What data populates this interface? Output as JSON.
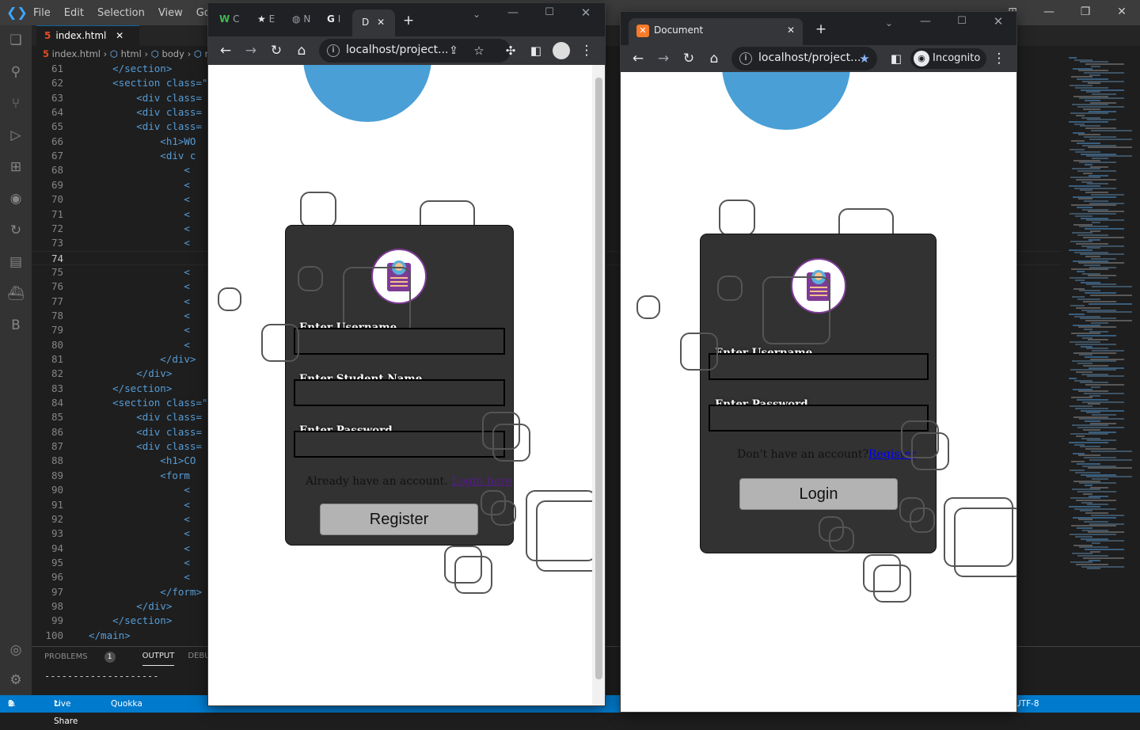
{
  "vscode": {
    "menu": [
      "File",
      "Edit",
      "Selection",
      "View",
      "Go"
    ],
    "tab_label": "index.html",
    "breadcrumb": [
      "index.html",
      "html",
      "body",
      "m"
    ],
    "active_line": "74",
    "lines": [
      {
        "n": "61",
        "code": "    </section>"
      },
      {
        "n": "62",
        "code": "    <section class=\""
      },
      {
        "n": "63",
        "code": "        <div class="
      },
      {
        "n": "64",
        "code": "        <div class="
      },
      {
        "n": "65",
        "code": "        <div class="
      },
      {
        "n": "66",
        "code": "            <h1>WO"
      },
      {
        "n": "67",
        "code": "            <div c"
      },
      {
        "n": "68",
        "code": "                <"
      },
      {
        "n": "69",
        "code": "                <"
      },
      {
        "n": "70",
        "code": "                <"
      },
      {
        "n": "71",
        "code": "                <"
      },
      {
        "n": "72",
        "code": "                <"
      },
      {
        "n": "73",
        "code": "                <"
      },
      {
        "n": "74",
        "code": ""
      },
      {
        "n": "75",
        "code": "                <"
      },
      {
        "n": "76",
        "code": "                <"
      },
      {
        "n": "77",
        "code": "                <"
      },
      {
        "n": "78",
        "code": "                <"
      },
      {
        "n": "79",
        "code": "                <"
      },
      {
        "n": "80",
        "code": "                <"
      },
      {
        "n": "81",
        "code": "            </div>"
      },
      {
        "n": "82",
        "code": "        </div>"
      },
      {
        "n": "83",
        "code": "    </section>"
      },
      {
        "n": "84",
        "code": "    <section class=\""
      },
      {
        "n": "85",
        "code": "        <div class="
      },
      {
        "n": "86",
        "code": "        <div class="
      },
      {
        "n": "87",
        "code": "        <div class="
      },
      {
        "n": "88",
        "code": "            <h1>CO"
      },
      {
        "n": "89",
        "code": "            <form"
      },
      {
        "n": "90",
        "code": "                <"
      },
      {
        "n": "91",
        "code": "                <"
      },
      {
        "n": "92",
        "code": "                <"
      },
      {
        "n": "93",
        "code": "                <"
      },
      {
        "n": "94",
        "code": "                <"
      },
      {
        "n": "95",
        "code": "                <"
      },
      {
        "n": "96",
        "code": "                <"
      },
      {
        "n": "97",
        "code": "            </form>"
      },
      {
        "n": "98",
        "code": "        </div>"
      },
      {
        "n": "99",
        "code": "    </section>"
      },
      {
        "n": "100",
        "code": "</main>"
      }
    ],
    "panel_tabs": [
      "PROBLEMS",
      "OUTPUT",
      "DEBUG CONSOL"
    ],
    "problems_count": "1",
    "output_text": "--------------------",
    "status": {
      "errors": "0",
      "warnings": "1",
      "live_share": "Live Share",
      "quokka": "Quokka",
      "encoding": "UTF-8"
    }
  },
  "chrome_left": {
    "tabs": [
      "C",
      "E",
      "N",
      "I",
      "D"
    ],
    "url": "localhost/project...",
    "form": {
      "username_label": "Enter Username",
      "student_label": "Enter Student Name",
      "password_label": "Enter Password",
      "prompt_text": "Already have an account.",
      "prompt_link": "Login here",
      "submit": "Register"
    }
  },
  "chrome_right": {
    "tab_title": "Document",
    "url": "localhost/project...",
    "incognito": "Incognito",
    "form": {
      "username_label": "Enter Username",
      "password_label": "Enter Password",
      "prompt_text": "Don't have an account?",
      "prompt_link": "Register",
      "submit": "Login"
    }
  },
  "colors": {
    "circle": "#4a9fd6",
    "card": "#323232",
    "button": "#b3b3b3",
    "vscode_status": "#007acc"
  }
}
